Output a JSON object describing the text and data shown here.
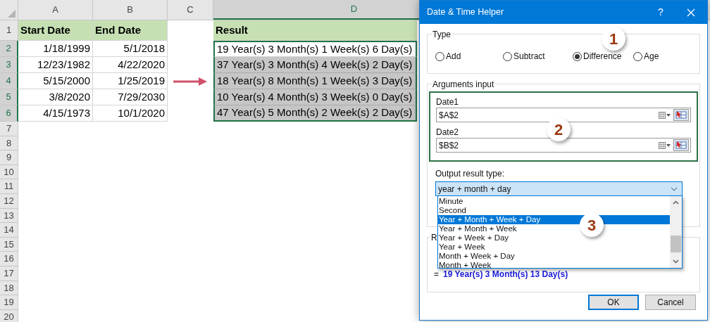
{
  "sheet": {
    "columns": [
      {
        "label": "A",
        "selected": false
      },
      {
        "label": "B",
        "selected": false
      },
      {
        "label": "C",
        "selected": false
      },
      {
        "label": "D",
        "selected": true
      }
    ],
    "rows": [
      {
        "number": "1",
        "kind": "header",
        "selected": false,
        "start": "Start Date",
        "end": "End Date",
        "result": "Result"
      },
      {
        "number": "2",
        "kind": "data",
        "selected": true,
        "active": true,
        "start": "1/18/1999",
        "end": "5/1/2018",
        "result": "19 Year(s) 3 Month(s) 1 Week(s) 6 Day(s)"
      },
      {
        "number": "3",
        "kind": "data",
        "selected": true,
        "active": false,
        "start": "12/23/1982",
        "end": "4/22/2020",
        "result": "37 Year(s) 3 Month(s) 4 Week(s) 2 Day(s)"
      },
      {
        "number": "4",
        "kind": "data",
        "selected": true,
        "active": false,
        "start": "5/15/2000",
        "end": "1/25/2019",
        "result": "18 Year(s) 8 Month(s) 1 Week(s) 3 Day(s)"
      },
      {
        "number": "5",
        "kind": "data",
        "selected": true,
        "active": false,
        "start": "3/8/2020",
        "end": "7/29/2030",
        "result": "10 Year(s) 4 Month(s) 3 Week(s) 0 Day(s)"
      },
      {
        "number": "6",
        "kind": "data",
        "selected": true,
        "active": false,
        "start": "4/15/1973",
        "end": "10/1/2020",
        "result": "47 Year(s) 5 Month(s) 2 Week(s) 2 Day(s)"
      }
    ],
    "empty_rows": [
      "7",
      "8",
      "9",
      "10",
      "11",
      "12",
      "13",
      "14",
      "15",
      "16",
      "17",
      "18",
      "19",
      "20"
    ]
  },
  "dialog": {
    "title": "Date & Time Helper",
    "help": "?",
    "type_group": {
      "label": "Type",
      "options": [
        {
          "label": "Add",
          "selected": false
        },
        {
          "label": "Subtract",
          "selected": false
        },
        {
          "label": "Difference",
          "selected": true
        },
        {
          "label": "Age",
          "selected": false
        }
      ]
    },
    "arguments_group": {
      "label": "Arguments input",
      "fields": [
        {
          "label": "Date1",
          "value": "$A$2"
        },
        {
          "label": "Date2",
          "value": "$B$2"
        }
      ]
    },
    "output": {
      "label": "Output result type:",
      "value": "year + month + day",
      "options": [
        {
          "label": "Minute",
          "selected": false
        },
        {
          "label": "Second",
          "selected": false
        },
        {
          "label": "Year + Month + Week + Day",
          "selected": true
        },
        {
          "label": "Year + Month + Week",
          "selected": false
        },
        {
          "label": "Year + Week + Day",
          "selected": false
        },
        {
          "label": "Year + Week",
          "selected": false
        },
        {
          "label": "Month + Week + Day",
          "selected": false
        },
        {
          "label": "Month + Week",
          "selected": false
        }
      ]
    },
    "result_group": {
      "label": "R",
      "equals": "=",
      "value": "19 Year(s) 3 Month(s) 13 Day(s)"
    },
    "buttons": [
      {
        "label": "OK",
        "default": true
      },
      {
        "label": "Cancel",
        "default": false
      }
    ],
    "badges": [
      "1",
      "2",
      "3"
    ]
  }
}
